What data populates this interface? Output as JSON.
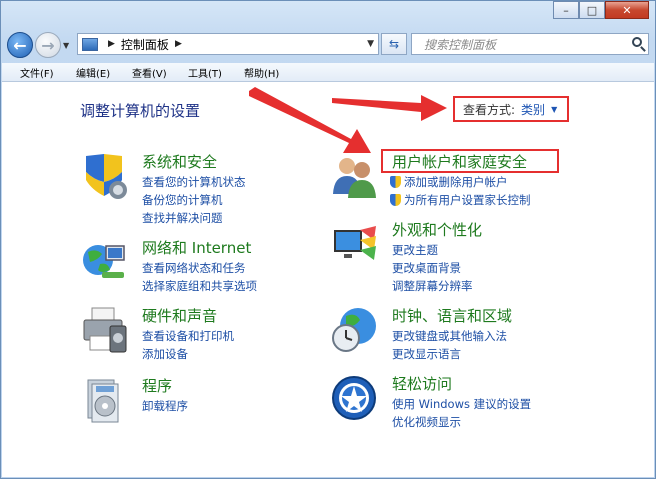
{
  "window": {
    "caption": {
      "minimize": "–",
      "maximize": "□",
      "close": "✕"
    }
  },
  "nav": {
    "address_parts": [
      "控制面板"
    ],
    "search_placeholder": "搜索控制面板"
  },
  "menu": [
    "文件(F)",
    "编辑(E)",
    "查看(V)",
    "工具(T)",
    "帮助(H)"
  ],
  "content": {
    "title": "调整计算机的设置",
    "view_by_label": "查看方式:",
    "view_by_value": "类别"
  },
  "categories_left": [
    {
      "icon": "shield-computer-icon",
      "head": "系统和安全",
      "links": [
        "查看您的计算机状态",
        "备份您的计算机",
        "查找并解决问题"
      ]
    },
    {
      "icon": "network-globe-icon",
      "head": "网络和 Internet",
      "links": [
        "查看网络状态和任务",
        "选择家庭组和共享选项"
      ]
    },
    {
      "icon": "printer-icon",
      "head": "硬件和声音",
      "links": [
        "查看设备和打印机",
        "添加设备"
      ]
    },
    {
      "icon": "programs-icon",
      "head": "程序",
      "links": [
        "卸载程序"
      ]
    }
  ],
  "categories_right": [
    {
      "icon": "users-icon",
      "head": "用户帐户和家庭安全",
      "links": [
        "添加或删除用户帐户",
        "为所有用户设置家长控制"
      ]
    },
    {
      "icon": "monitor-palette-icon",
      "head": "外观和个性化",
      "links": [
        "更改主题",
        "更改桌面背景",
        "调整屏幕分辨率"
      ]
    },
    {
      "icon": "clock-globe-icon",
      "head": "时钟、语言和区域",
      "links": [
        "更改键盘或其他输入法",
        "更改显示语言"
      ]
    },
    {
      "icon": "accessibility-icon",
      "head": "轻松访问",
      "links": [
        "使用 Windows 建议的设置",
        "优化视频显示"
      ]
    }
  ],
  "colors": {
    "annotation_red": "#e52f2f",
    "link_blue": "#1e4fa5",
    "head_green": "#1e7a1e"
  }
}
